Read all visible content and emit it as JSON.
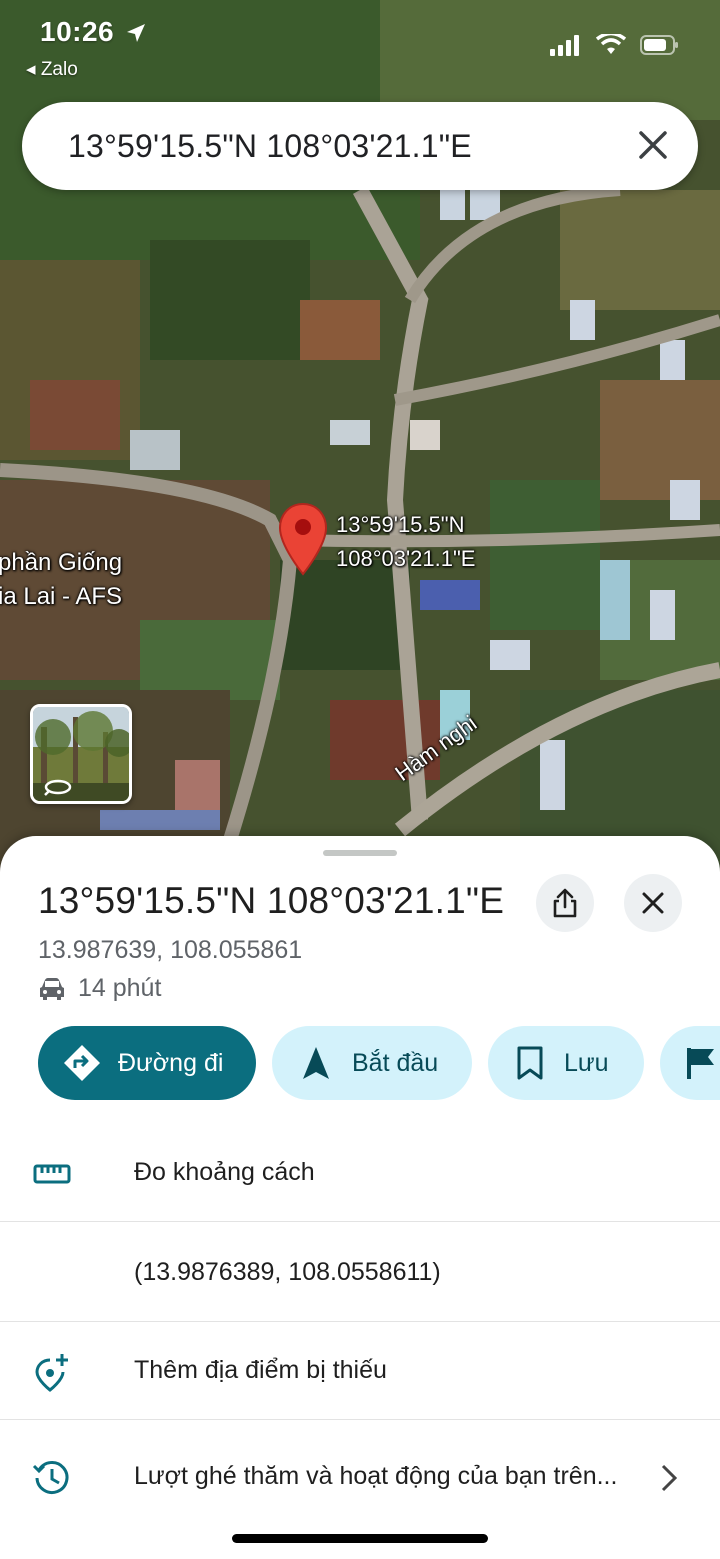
{
  "status_bar": {
    "time": "10:26",
    "back_app": "◂ Zalo"
  },
  "search": {
    "query": "13°59'15.5\"N 108°03'21.1\"E"
  },
  "map": {
    "pin_label": "13°59'15.5\"N\n108°03'21.1\"E",
    "poi_label": "phần Giống\nia Lai - AFS",
    "street_label": "Hàm nghi"
  },
  "sheet": {
    "title": "13°59'15.5\"N 108°03'21.1\"E",
    "decimal_coords": "13.987639, 108.055861",
    "eta": "14 phút",
    "actions": [
      {
        "label": "Đường đi"
      },
      {
        "label": "Bắt đầu"
      },
      {
        "label": "Lưu"
      },
      {
        "label": ""
      }
    ],
    "list": [
      {
        "label": "Đo khoảng cách"
      },
      {
        "label": "(13.9876389, 108.0558611)"
      },
      {
        "label": "Thêm địa điểm bị thiếu"
      },
      {
        "label": "Lượt ghé thăm và hoạt động của bạn trên..."
      }
    ]
  },
  "colors": {
    "primary": "#0b6e7f",
    "tonal": "#d3f2fb",
    "pin": "#ea4335"
  }
}
